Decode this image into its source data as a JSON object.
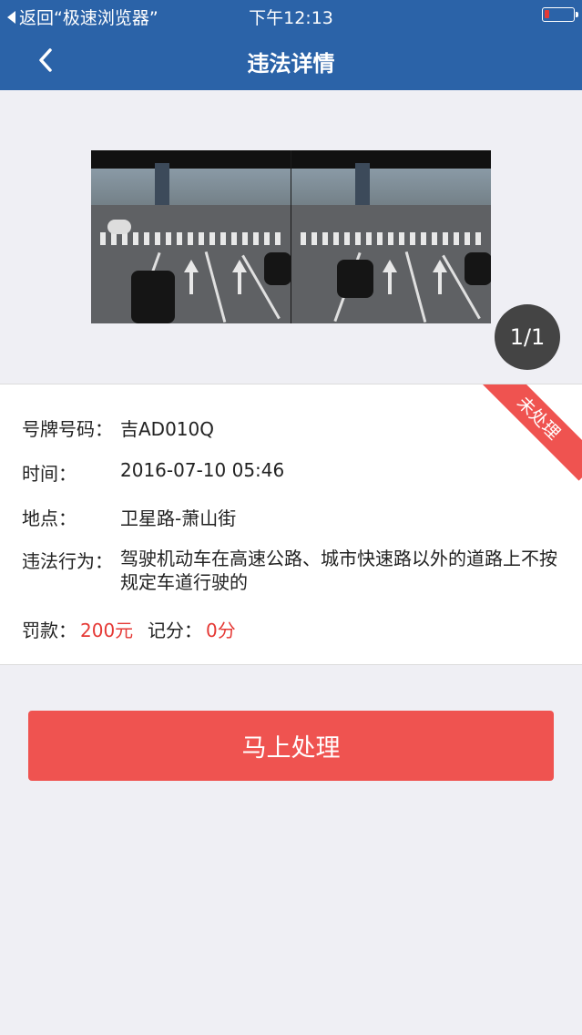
{
  "status": {
    "back_label": "返回“极速浏览器”",
    "time": "下午12:13",
    "battery_color": "#e53935"
  },
  "nav": {
    "title": "违法详情",
    "back_icon": "chevron-left-icon"
  },
  "photo": {
    "counter": "1/1"
  },
  "violation": {
    "status_badge": "未处理",
    "plate_label": "号牌号码：",
    "plate_value": "吉AD010Q",
    "time_label": "时间：",
    "time_value": "2016-07-10 05:46",
    "location_label": "地点：",
    "location_value": "卫星路-萧山街",
    "behavior_label": "违法行为：",
    "behavior_value": "驾驶机动车在高速公路、城市快速路以外的道路上不按规定车道行驶的",
    "fine_label": "罚款：",
    "fine_value": "200元",
    "points_label": "记分：",
    "points_value": "0分"
  },
  "action": {
    "button_label": "马上处理"
  },
  "colors": {
    "brand_blue": "#2b63a8",
    "accent_red": "#ef5350"
  }
}
